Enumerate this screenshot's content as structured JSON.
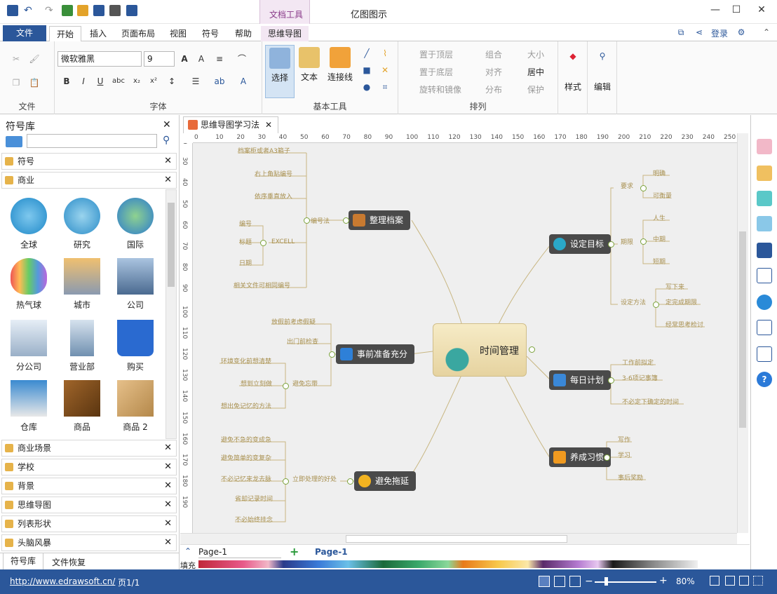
{
  "app": {
    "title": "亿图图示",
    "context_tab_group": "文档工具"
  },
  "tabs": {
    "file": "文件",
    "home": "开始",
    "insert": "插入",
    "page_layout": "页面布局",
    "view": "视图",
    "symbol": "符号",
    "help": "帮助",
    "mindmap": "思维导图"
  },
  "account": {
    "login": "登录"
  },
  "ribbon": {
    "groups": {
      "file": "文件",
      "font": "字体",
      "basic_tools": "基本工具",
      "arrange": "排列",
      "style": "样式",
      "edit": "编辑"
    },
    "font_name": "微软雅黑",
    "font_size": "9",
    "tools": {
      "select": "选择",
      "text": "文本",
      "connector": "连接线"
    },
    "arrange": {
      "bring_front": "置于顶层",
      "send_back": "置于底层",
      "rotate_mirror": "旋转和镜像",
      "group": "组合",
      "align": "对齐",
      "distribute": "分布",
      "size": "大小",
      "center": "居中",
      "protect": "保护"
    }
  },
  "library": {
    "title": "符号库",
    "categories_top": [
      "符号",
      "商业"
    ],
    "symbols": [
      "全球",
      "研究",
      "国际",
      "热气球",
      "城市",
      "公司",
      "分公司",
      "营业部",
      "购买",
      "仓库",
      "商品",
      "商品 2"
    ],
    "categories_bottom": [
      "商业场景",
      "学校",
      "背景",
      "思维导图",
      "列表形状",
      "头脑风暴"
    ],
    "bottom_tabs": [
      "符号库",
      "文件恢复"
    ]
  },
  "document": {
    "tab_title": "思维导图学习法",
    "ruler_h": [
      "0",
      "10",
      "20",
      "30",
      "40",
      "50",
      "60",
      "70",
      "80",
      "90",
      "100",
      "110",
      "120",
      "130",
      "140",
      "150",
      "160",
      "170",
      "180",
      "190",
      "200",
      "210",
      "220",
      "230",
      "240",
      "250"
    ],
    "ruler_v": [
      "20",
      "30",
      "40",
      "50",
      "60",
      "70",
      "80",
      "90",
      "100",
      "110",
      "120",
      "130",
      "140",
      "150",
      "160",
      "170",
      "180",
      "190"
    ],
    "page_name": "Page-1",
    "page_tab": "Page-1",
    "fill_label": "填充"
  },
  "mindmap": {
    "center": "时间管理",
    "topics": {
      "archive": {
        "title": "整理档案",
        "sub": "编号法",
        "sub2": "EXCELL",
        "items": [
          "档案柜或者A3箱子",
          "右上角贴编号",
          "依序垂直放入",
          "编号",
          "标题",
          "日期",
          "相关文件可相同编号"
        ]
      },
      "prepare": {
        "title": "事前准备充分",
        "sub": "避免忘带",
        "items": [
          "放假前考虑假疑",
          "出门前检查",
          "环境变化前想清楚",
          "想到立刻做",
          "想出免记忆的方法"
        ]
      },
      "delay": {
        "title": "避免拖延",
        "sub": "立即处理的好处",
        "items": [
          "避免不急的变成急",
          "避免简单的变复杂",
          "不必记忆来龙去脉",
          "省却记录时间",
          "不必始终挂念"
        ]
      },
      "goal": {
        "title": "设定目标",
        "subs": [
          "要求",
          "期限",
          "设定方法"
        ],
        "items": [
          "明确",
          "可衡量",
          "人生",
          "中期",
          "短期",
          "写下来",
          "定完成期限",
          "经常思考检讨"
        ]
      },
      "plan": {
        "title": "每日计划",
        "items": [
          "工作前拟定",
          "3-6项记事簿",
          "不必定下确定的时间"
        ]
      },
      "habit": {
        "title": "养成习惯",
        "items": [
          "写作",
          "学习",
          "事后奖励"
        ]
      }
    }
  },
  "status": {
    "url": "http://www.edrawsoft.cn/",
    "page_info": "页1/1",
    "zoom": "80%"
  },
  "colors": {
    "brand": "#2b579a",
    "node": "#4a4a4a",
    "center": "#f0e2b8",
    "branch": "#c8b682"
  }
}
